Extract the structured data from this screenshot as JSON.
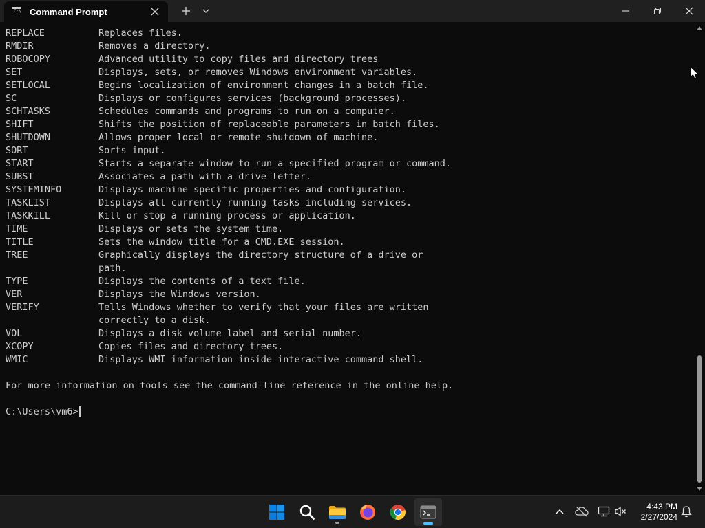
{
  "window": {
    "tab_title": "Command Prompt",
    "tab_icon_glyph": "C:\\"
  },
  "terminal": {
    "commands": [
      {
        "name": "REPLACE",
        "desc": "Replaces files."
      },
      {
        "name": "RMDIR",
        "desc": "Removes a directory."
      },
      {
        "name": "ROBOCOPY",
        "desc": "Advanced utility to copy files and directory trees"
      },
      {
        "name": "SET",
        "desc": "Displays, sets, or removes Windows environment variables."
      },
      {
        "name": "SETLOCAL",
        "desc": "Begins localization of environment changes in a batch file."
      },
      {
        "name": "SC",
        "desc": "Displays or configures services (background processes)."
      },
      {
        "name": "SCHTASKS",
        "desc": "Schedules commands and programs to run on a computer."
      },
      {
        "name": "SHIFT",
        "desc": "Shifts the position of replaceable parameters in batch files."
      },
      {
        "name": "SHUTDOWN",
        "desc": "Allows proper local or remote shutdown of machine."
      },
      {
        "name": "SORT",
        "desc": "Sorts input."
      },
      {
        "name": "START",
        "desc": "Starts a separate window to run a specified program or command."
      },
      {
        "name": "SUBST",
        "desc": "Associates a path with a drive letter."
      },
      {
        "name": "SYSTEMINFO",
        "desc": "Displays machine specific properties and configuration."
      },
      {
        "name": "TASKLIST",
        "desc": "Displays all currently running tasks including services."
      },
      {
        "name": "TASKKILL",
        "desc": "Kill or stop a running process or application."
      },
      {
        "name": "TIME",
        "desc": "Displays or sets the system time."
      },
      {
        "name": "TITLE",
        "desc": "Sets the window title for a CMD.EXE session."
      },
      {
        "name": "TREE",
        "desc": "Graphically displays the directory structure of a drive or"
      },
      {
        "name": "",
        "desc": "path."
      },
      {
        "name": "TYPE",
        "desc": "Displays the contents of a text file."
      },
      {
        "name": "VER",
        "desc": "Displays the Windows version."
      },
      {
        "name": "VERIFY",
        "desc": "Tells Windows whether to verify that your files are written"
      },
      {
        "name": "",
        "desc": "correctly to a disk."
      },
      {
        "name": "VOL",
        "desc": "Displays a disk volume label and serial number."
      },
      {
        "name": "XCOPY",
        "desc": "Copies files and directory trees."
      },
      {
        "name": "WMIC",
        "desc": "Displays WMI information inside interactive command shell."
      }
    ],
    "footer": "For more information on tools see the command-line reference in the online help.",
    "prompt": "C:\\Users\\vm6>"
  },
  "taskbar": {
    "apps": [
      {
        "name": "start",
        "icon": "windows-logo-icon"
      },
      {
        "name": "search",
        "icon": "search-icon"
      },
      {
        "name": "file-explorer",
        "icon": "folder-icon"
      },
      {
        "name": "firefox",
        "icon": "firefox-icon"
      },
      {
        "name": "chrome",
        "icon": "chrome-icon"
      },
      {
        "name": "terminal",
        "icon": "terminal-icon"
      }
    ],
    "clock": {
      "time": "4:43 PM",
      "date": "2/27/2024"
    }
  },
  "colors": {
    "terminal_bg": "#0c0c0c",
    "terminal_fg": "#cccccc",
    "titlebar_bg": "#202020",
    "taskbar_bg": "#1c1c1c",
    "accent": "#4cc2ff"
  }
}
